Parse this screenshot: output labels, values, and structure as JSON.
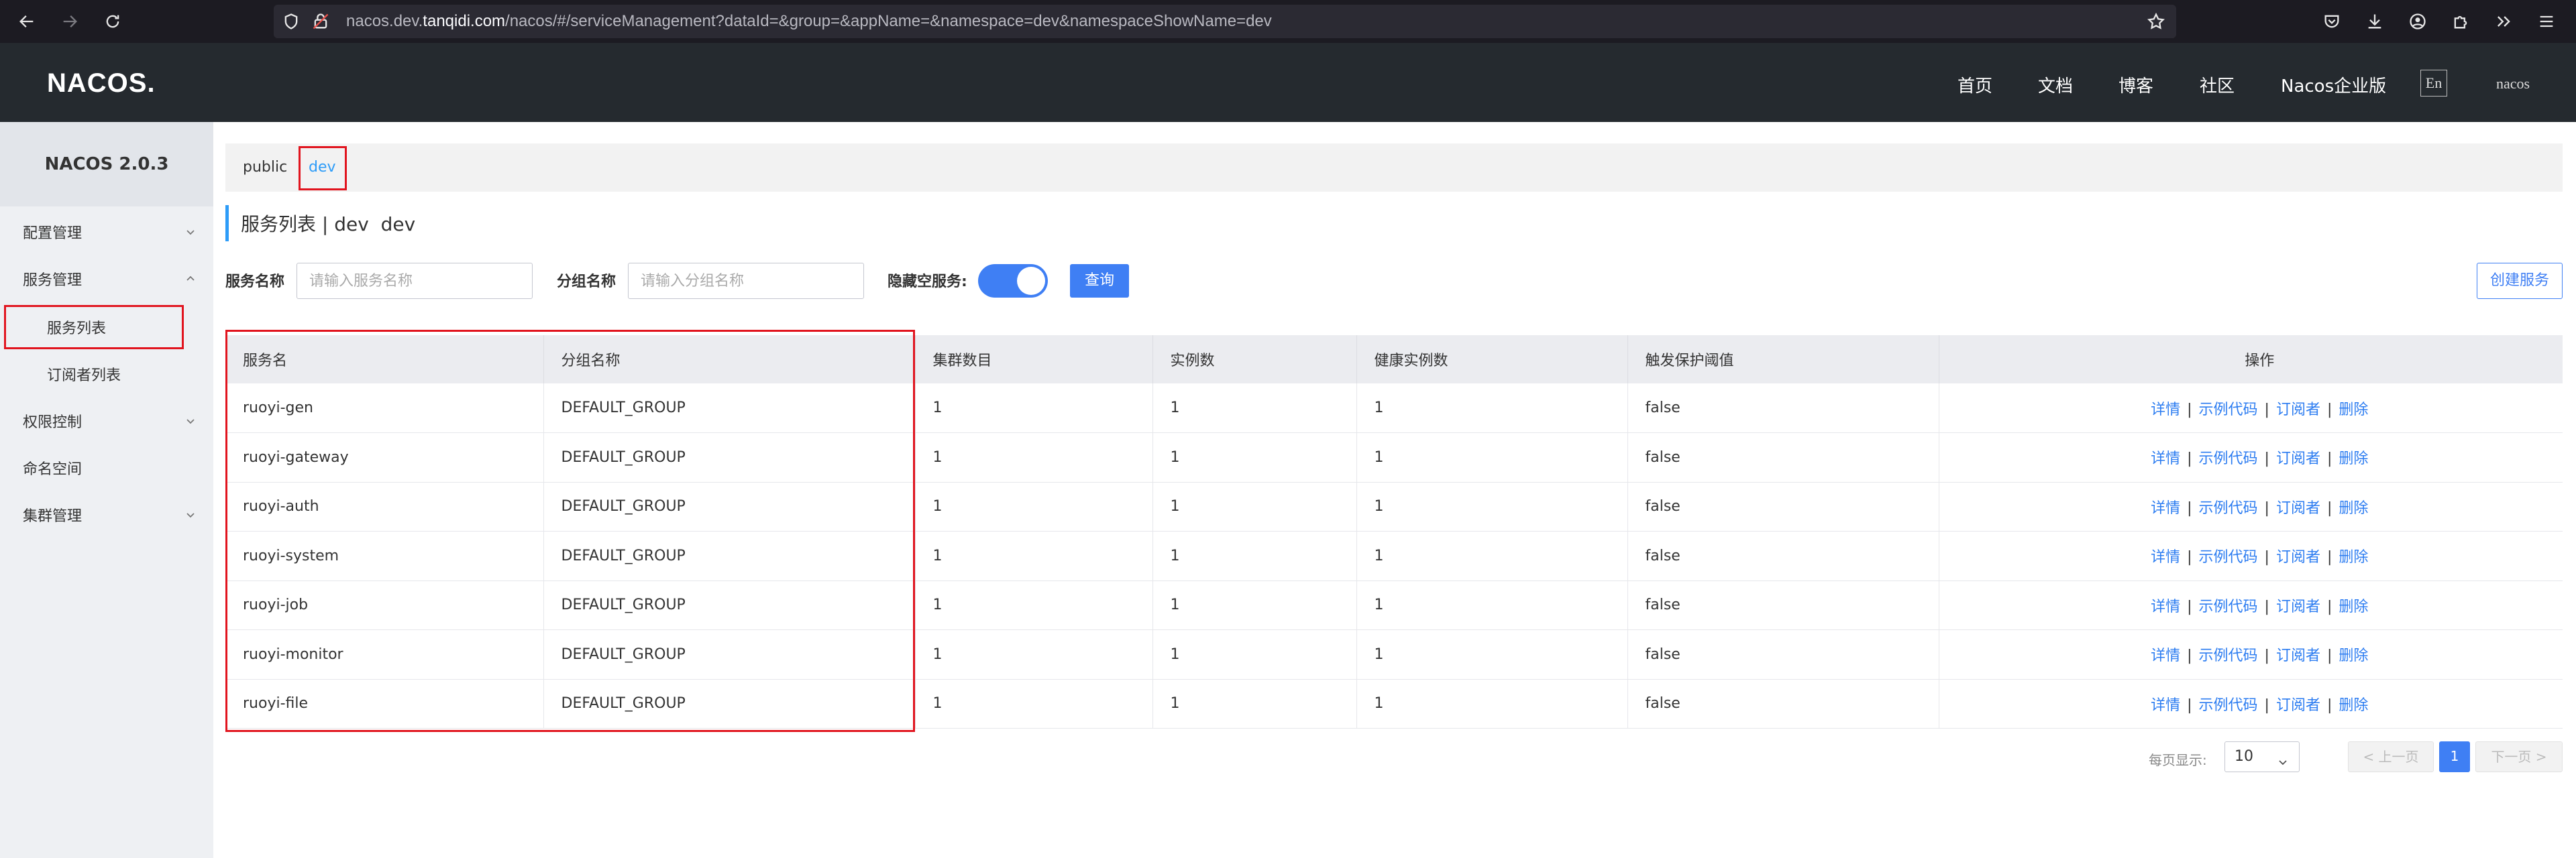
{
  "browser": {
    "url_host_prefix": "nacos.dev.",
    "url_host_main": "tanqidi.com",
    "url_path": "/nacos/#/serviceManagement?dataId=&group=&appName=&namespace=dev&namespaceShowName=dev"
  },
  "header": {
    "logo": "NACOS.",
    "nav": [
      "首页",
      "文档",
      "博客",
      "社区",
      "Nacos企业版"
    ],
    "lang": "En",
    "user": "nacos"
  },
  "sidebar": {
    "title": "NACOS 2.0.3",
    "items": [
      {
        "label": "配置管理"
      },
      {
        "label": "服务管理"
      },
      {
        "label": "服务列表"
      },
      {
        "label": "订阅者列表"
      },
      {
        "label": "权限控制"
      },
      {
        "label": "命名空间"
      },
      {
        "label": "集群管理"
      }
    ]
  },
  "namespace_tabs": [
    "public",
    "dev"
  ],
  "page": {
    "title": "服务列表 | dev  dev"
  },
  "filters": {
    "service_label": "服务名称",
    "service_placeholder": "请输入服务名称",
    "group_label": "分组名称",
    "group_placeholder": "请输入分组名称",
    "hide_empty_label": "隐藏空服务:",
    "hide_empty_on": true,
    "query_button": "查询",
    "create_button": "创建服务"
  },
  "table": {
    "columns": [
      "服务名",
      "分组名称",
      "集群数目",
      "实例数",
      "健康实例数",
      "触发保护阈值",
      "操作"
    ],
    "rows": [
      [
        "ruoyi-gen",
        "DEFAULT_GROUP",
        "1",
        "1",
        "1",
        "false"
      ],
      [
        "ruoyi-gateway",
        "DEFAULT_GROUP",
        "1",
        "1",
        "1",
        "false"
      ],
      [
        "ruoyi-auth",
        "DEFAULT_GROUP",
        "1",
        "1",
        "1",
        "false"
      ],
      [
        "ruoyi-system",
        "DEFAULT_GROUP",
        "1",
        "1",
        "1",
        "false"
      ],
      [
        "ruoyi-job",
        "DEFAULT_GROUP",
        "1",
        "1",
        "1",
        "false"
      ],
      [
        "ruoyi-monitor",
        "DEFAULT_GROUP",
        "1",
        "1",
        "1",
        "false"
      ],
      [
        "ruoyi-file",
        "DEFAULT_GROUP",
        "1",
        "1",
        "1",
        "false"
      ]
    ],
    "actions": [
      "详情",
      "示例代码",
      "订阅者",
      "删除"
    ],
    "action_separator": "|"
  },
  "pagination": {
    "page_size_label": "每页显示:",
    "page_size": "10",
    "prev": "< 上一页",
    "current": "1",
    "next": "下一页 >"
  },
  "colors": {
    "accent": "#3f7ff4",
    "highlight_box": "#e1141e",
    "header_bg": "#252a2f"
  }
}
